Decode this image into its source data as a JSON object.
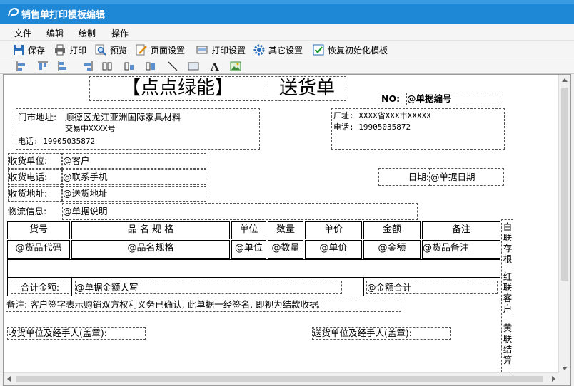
{
  "window": {
    "title": "销售单打印模板编辑"
  },
  "menu": [
    "文件",
    "编辑",
    "绘制",
    "操作"
  ],
  "toolbar": {
    "save": "保存",
    "print": "打印",
    "preview": "预览",
    "page_setup": "页面设置",
    "print_setup": "打印设置",
    "other_setup": "其它设置",
    "restore": "恢复初始化模板"
  },
  "draw_tools": [
    "align-left-icon",
    "align-top-icon",
    "align-bottom-icon",
    "align-right-icon",
    "same-width-icon",
    "same-height-icon",
    "same-size-icon",
    "line-tool-icon",
    "rectangle-tool-icon",
    "text-tool-icon",
    "image-tool-icon"
  ],
  "template": {
    "title_brand": "【点点绿能】",
    "title_doc": "送货单",
    "no_label": "NO:",
    "no_field": "@单据编号",
    "store_address_label": "门市地址:",
    "store_address_line1": "顺德区龙江亚洲国际家具材料",
    "store_address_line2": "交易中XXXX号",
    "store_phone": "电话: 19905035872",
    "factory_address": "厂址: XXXX省XXX市XXXXX",
    "factory_phone": "电话: 19905035872",
    "receiver_unit_label": "收货单位:",
    "receiver_unit_field": "@客户",
    "receiver_phone_label": "收货电话:",
    "receiver_phone_field": "@联系手机",
    "receiver_address_label": "收货地址:",
    "receiver_address_field": "@送货地址",
    "logistics_label": "物流信息:",
    "logistics_field": "@单据说明",
    "date_label": "日期:",
    "date_field": "@单据日期",
    "table": {
      "headers": [
        "货号",
        "品 名 规 格",
        "单位",
        "数量",
        "单价",
        "金额",
        "备注"
      ],
      "fields": [
        "@货品代码",
        "@品名规格",
        "@单位",
        "@数量",
        "@单价",
        "@金额",
        "@货品备注"
      ],
      "total_label": "合计金额:",
      "total_upper_field": "@单据金额大写",
      "total_field": "@金额合计"
    },
    "note": "备注: 客户签字表示购销双方权利义务已确认, 此单据一经签名, 即视为结款收据。",
    "receiver_sign": "收货单位及经手人(盖章):",
    "sender_sign": "送货单位及经手人(盖章):",
    "side_copies": [
      "白联存根",
      "红联客户",
      "黄联结算"
    ]
  },
  "colors": {
    "titlebar": "#1e87d6",
    "canvas": "#ffffff"
  }
}
